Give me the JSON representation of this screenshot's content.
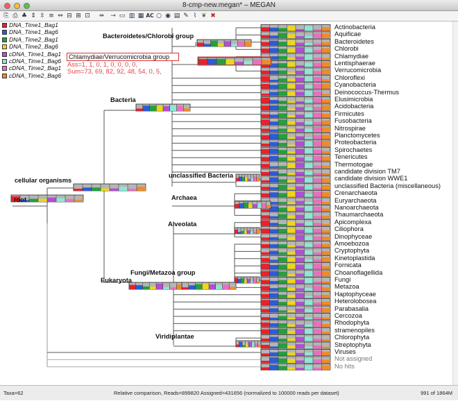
{
  "window": {
    "title": "8-cmp-new.megan* – MEGAN"
  },
  "toolbar": {
    "icons": [
      "copy",
      "print",
      "tree",
      "expand",
      "collapse",
      "collapse-all",
      "uncollapse",
      "zoom-out",
      "zoom-in",
      "node-size",
      "select",
      "bar-chart",
      "AC",
      "circle",
      "target",
      "blocks",
      "tools",
      "comb",
      "leaf",
      "close-x"
    ],
    "ac_label": "AC"
  },
  "legend": [
    {
      "label": "DNA_Time1_Bag1",
      "color": "#e8212a"
    },
    {
      "label": "DNA_Time1_Bag6",
      "color": "#2e5bd6"
    },
    {
      "label": "DNA_Time2_Bag1",
      "color": "#21a23a"
    },
    {
      "label": "DNA_Time2_Bag6",
      "color": "#ecd61f"
    },
    {
      "label": "cDNA_Time1_Bag1",
      "color": "#b04fd5"
    },
    {
      "label": "cDNA_Time1_Bag6",
      "color": "#8fe6d4"
    },
    {
      "label": "cDNA_Time2_Bag1",
      "color": "#e86fc0"
    },
    {
      "label": "cDNA_Time2_Bag6",
      "color": "#f08a2a"
    }
  ],
  "nodes": {
    "root": "root",
    "cellular": "cellular organisms",
    "bacteria": "Bacteria",
    "bacteroidetes": "Bacteroidetes/Chlorobi group",
    "unclassified": "unclassified Bacteria",
    "archaea": "Archaea",
    "alveolata": "Alveolata",
    "fungi": "Fungi/Metazoa group",
    "eukaryota": "Eukaryota",
    "viridiplantae": "Viridiplantae"
  },
  "tooltip": {
    "title": "Chlamydiae/Verrucomicrobia group",
    "ass": "Ass=1, 1, 0, 1, 0, 0, 0, 0,",
    "sum": "Sum=73, 69, 82, 92, 48, 54, 0, 5,"
  },
  "leaves": [
    {
      "name": "Actinobacteria"
    },
    {
      "name": "Aquificae"
    },
    {
      "name": "Bacteroidetes"
    },
    {
      "name": "Chlorobi"
    },
    {
      "name": "Chlamydiae"
    },
    {
      "name": "Lentisphaerae"
    },
    {
      "name": "Verrucomicrobia"
    },
    {
      "name": "Chloroflexi"
    },
    {
      "name": "Cyanobacteria"
    },
    {
      "name": "Deinococcus-Thermus"
    },
    {
      "name": "Elusimicrobia"
    },
    {
      "name": "Acidobacteria"
    },
    {
      "name": "Firmicutes"
    },
    {
      "name": "Fusobacteria"
    },
    {
      "name": "Nitrospirae"
    },
    {
      "name": "Planctomycetes"
    },
    {
      "name": "Proteobacteria"
    },
    {
      "name": "Spirochaetes"
    },
    {
      "name": "Tenericutes"
    },
    {
      "name": "Thermotogae"
    },
    {
      "name": "candidate division TM7"
    },
    {
      "name": "candidate division WWE1"
    },
    {
      "name": "unclassified Bacteria (miscellaneous)"
    },
    {
      "name": "Crenarchaeota"
    },
    {
      "name": "Euryarchaeota"
    },
    {
      "name": "Nanoarchaeota"
    },
    {
      "name": "Thaumarchaeota"
    },
    {
      "name": "Apicomplexa"
    },
    {
      "name": "Ciliophora"
    },
    {
      "name": "Dinophyceae"
    },
    {
      "name": "Amoebozoa"
    },
    {
      "name": "Cryptophyta"
    },
    {
      "name": "Kinetoplastida"
    },
    {
      "name": "Fornicata"
    },
    {
      "name": "Choanoflagellida"
    },
    {
      "name": "Fungi"
    },
    {
      "name": "Metazoa"
    },
    {
      "name": "Haptophyceae"
    },
    {
      "name": "Heterolobosea"
    },
    {
      "name": "Parabasalia"
    },
    {
      "name": "Cercozoa"
    },
    {
      "name": "Rhodophyta"
    },
    {
      "name": "stramenopiles"
    },
    {
      "name": "Chlorophyta"
    },
    {
      "name": "Streptophyta"
    },
    {
      "name": "Viruses"
    },
    {
      "name": "Not assigned",
      "grey": true
    },
    {
      "name": "No hits",
      "grey": true
    }
  ],
  "status": {
    "taxa": "Taxa=62",
    "middle": "Relative comparison, Reads=899820  Assigned=431656 (normalized to 100000 reads per dataset)",
    "memory": "991 of 1864M"
  }
}
